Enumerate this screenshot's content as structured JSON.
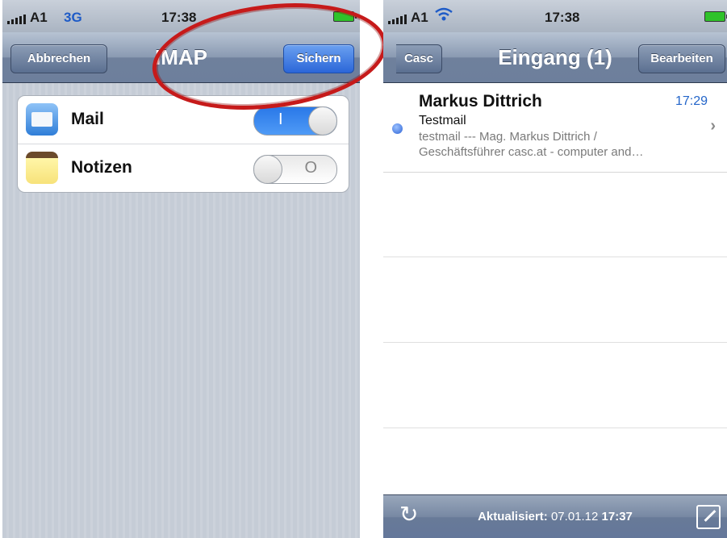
{
  "left": {
    "status": {
      "carrier": "A1",
      "network": "3G",
      "time": "17:38"
    },
    "nav": {
      "title": "IMAP",
      "cancel_label": "Abbrechen",
      "save_label": "Sichern"
    },
    "settings": [
      {
        "label": "Mail",
        "icon": "mail-icon",
        "on": true
      },
      {
        "label": "Notizen",
        "icon": "notes-icon",
        "on": false
      }
    ],
    "toggle_on_mark": "I",
    "toggle_off_mark": "O"
  },
  "right": {
    "status": {
      "carrier": "A1",
      "time": "17:38"
    },
    "nav": {
      "title": "Eingang (1)",
      "back_label": "Casc",
      "edit_label": "Bearbeiten"
    },
    "messages": [
      {
        "sender": "Markus Dittrich",
        "time": "17:29",
        "subject": "Testmail",
        "preview_line1": "testmail --- Mag. Markus Dittrich /",
        "preview_line2": "Geschäftsführer casc.at - computer and…",
        "unread": true
      }
    ],
    "toolbar": {
      "updated_label": "Aktualisiert:",
      "updated_date": "07.01.12",
      "updated_time": "17:37"
    }
  },
  "colors": {
    "annotation": "#c61a1a",
    "accent_blue": "#2365c9",
    "toggle_on": "#2a78e8"
  }
}
